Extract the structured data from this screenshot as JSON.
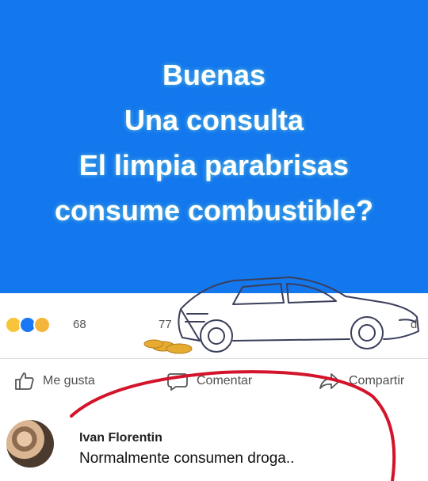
{
  "post": {
    "lines": [
      "Buenas",
      "Una consulta",
      "El limpia parabrisas",
      "consume combustible?"
    ]
  },
  "reactions": {
    "icons": [
      "haha-icon",
      "like-icon",
      "wow-icon"
    ],
    "count": "68",
    "comments_fragment": "77",
    "shares_fragment": "d"
  },
  "actions": {
    "like": "Me gusta",
    "comment": "Comentar",
    "share": "Compartir"
  },
  "comment": {
    "author": "Ivan Florentin",
    "text": "Normalmente consumen droga.."
  },
  "colors": {
    "post_background": "#1377ee",
    "annotation_red": "#d3142a"
  }
}
